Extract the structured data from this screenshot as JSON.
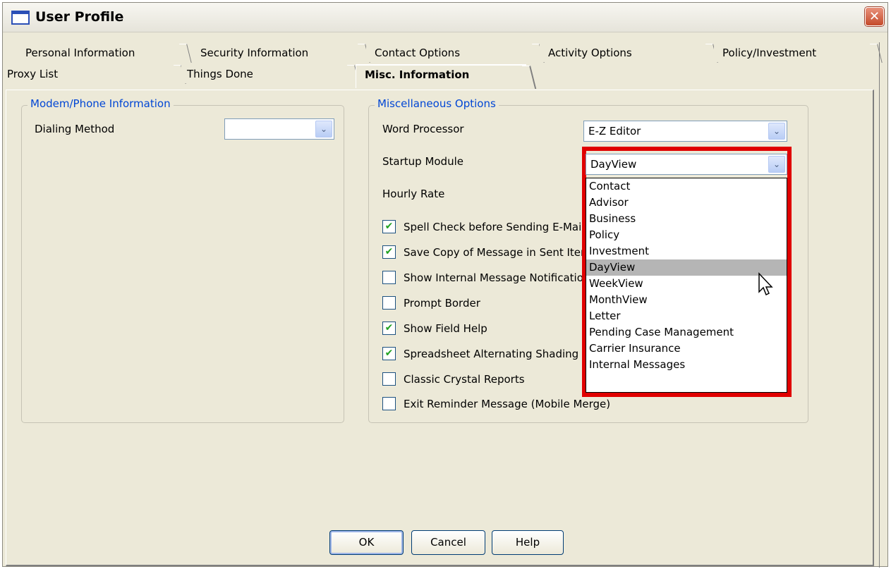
{
  "window": {
    "title": "User Profile",
    "close_symbol": "✕"
  },
  "tabs_row1": [
    {
      "label": "Personal Information"
    },
    {
      "label": "Security Information"
    },
    {
      "label": "Contact Options"
    },
    {
      "label": "Activity Options"
    },
    {
      "label": "Policy/Investment"
    }
  ],
  "tabs_row2": [
    {
      "label": "Proxy List"
    },
    {
      "label": "Things Done"
    },
    {
      "label": "Misc. Information"
    }
  ],
  "modem": {
    "title": "Modem/Phone Information",
    "dialing_label": "Dialing Method",
    "dialing_value": ""
  },
  "misc": {
    "title": "Miscellaneous Options",
    "word_processor_label": "Word Processor",
    "word_processor_value": "E-Z Editor",
    "startup_label": "Startup Module",
    "startup_value": "DayView",
    "hourly_label": "Hourly Rate",
    "checkboxes": [
      {
        "label": "Spell Check before Sending E-Mail",
        "checked": true,
        "mark": "✔"
      },
      {
        "label": "Save Copy of Message in Sent Items",
        "checked": true,
        "mark": "✔"
      },
      {
        "label": "Show Internal Message Notification",
        "checked": false,
        "mark": ""
      },
      {
        "label": "Prompt Border",
        "checked": false,
        "mark": ""
      },
      {
        "label": "Show Field Help",
        "checked": true,
        "mark": "✔"
      },
      {
        "label": "Spreadsheet Alternating Shading",
        "checked": true,
        "mark": "✔"
      },
      {
        "label": "Classic Crystal Reports",
        "checked": false,
        "mark": ""
      },
      {
        "label": "Exit Reminder Message (Mobile Merge)",
        "checked": false,
        "mark": ""
      }
    ]
  },
  "startup_options": [
    "Contact",
    "Advisor",
    "Business",
    "Policy",
    "Investment",
    "DayView",
    "WeekView",
    "MonthView",
    "Letter",
    "Pending Case Management",
    "Carrier Insurance",
    "Internal Messages"
  ],
  "selected_option_index": 5,
  "buttons": {
    "ok": "OK",
    "cancel": "Cancel",
    "help": "Help"
  },
  "colors": {
    "accent_group_title": "#0046d5",
    "highlight_frame": "#e00000",
    "check_mark": "#21a121"
  },
  "icons": {
    "dropdown_arrow": "⌄",
    "cursor": "arrow-pointer-icon"
  }
}
